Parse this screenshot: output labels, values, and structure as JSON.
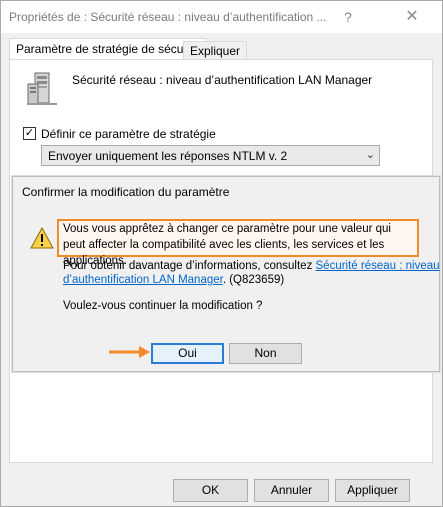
{
  "window": {
    "title": "Propriétés de : Sécurité réseau : niveau d’authentification ...",
    "help_label": "?",
    "close_label": "✕"
  },
  "tabs": [
    {
      "label": "Paramètre de stratégie de sécurité",
      "active": true
    },
    {
      "label": "Expliquer",
      "active": false
    }
  ],
  "policy": {
    "name": "Sécurité réseau : niveau d’authentification LAN Manager",
    "define_checkbox_checked": true,
    "define_label": "Définir ce paramètre de stratégie",
    "selected_value": "Envoyer uniquement les réponses NTLM v. 2"
  },
  "buttons": {
    "ok": "OK",
    "cancel": "Annuler",
    "apply": "Appliquer"
  },
  "dialog": {
    "title": "Confirmer la modification du paramètre",
    "message": "Vous vous apprêtez à changer ce paramètre pour une valeur qui peut affecter la compatibilité avec les clients, les services et les applications.",
    "info_prefix": "Pour obtenir davantage d’informations, consultez ",
    "info_link": "Sécurité réseau : niveau d’authentification LAN Manager",
    "info_suffix": ". (Q823659)",
    "question": "Voulez-vous continuer la modification ?",
    "yes_label": "Oui",
    "no_label": "Non"
  },
  "colors": {
    "highlight_border": "#f28a2a",
    "annotation_arrow": "#f28a2a",
    "link": "#0066cc",
    "default_button_border": "#2b7ad6"
  }
}
